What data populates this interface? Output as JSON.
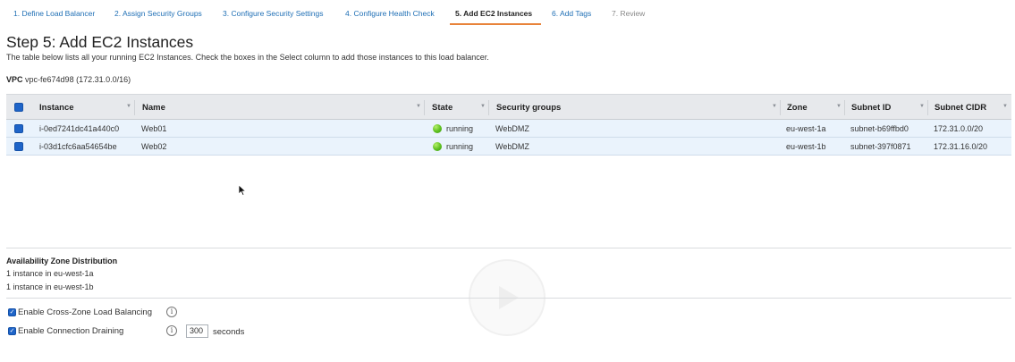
{
  "wizard": {
    "steps": [
      {
        "label": "1. Define Load Balancer"
      },
      {
        "label": "2. Assign Security Groups"
      },
      {
        "label": "3. Configure Security Settings"
      },
      {
        "label": "4. Configure Health Check"
      },
      {
        "label": "5. Add EC2 Instances"
      },
      {
        "label": "6. Add Tags"
      },
      {
        "label": "7. Review"
      }
    ],
    "active_step": 5
  },
  "page": {
    "title": "Step 5: Add EC2 Instances",
    "description": "The table below lists all your running EC2 Instances. Check the boxes in the Select column to add those instances to this load balancer."
  },
  "vpc": {
    "label": "VPC",
    "value": "vpc-fe674d98 (172.31.0.0/16)"
  },
  "table": {
    "columns": [
      "Instance",
      "Name",
      "State",
      "Security groups",
      "Zone",
      "Subnet ID",
      "Subnet CIDR"
    ],
    "rows": [
      {
        "instance": "i-0ed7241dc41a440c0",
        "name": "Web01",
        "state": "running",
        "security_groups": "WebDMZ",
        "zone": "eu-west-1a",
        "subnet_id": "subnet-b69ffbd0",
        "subnet_cidr": "172.31.0.0/20",
        "selected": true
      },
      {
        "instance": "i-03d1cfc6aa54654be",
        "name": "Web02",
        "state": "running",
        "security_groups": "WebDMZ",
        "zone": "eu-west-1b",
        "subnet_id": "subnet-397f0871",
        "subnet_cidr": "172.31.16.0/20",
        "selected": true
      }
    ]
  },
  "az_distribution": {
    "title": "Availability Zone Distribution",
    "lines": [
      "1 instance in eu-west-1a",
      "1 instance in eu-west-1b"
    ]
  },
  "options": {
    "cross_zone": {
      "label": "Enable Cross-Zone Load Balancing",
      "checked": true
    },
    "connection_draining": {
      "label": "Enable Connection Draining",
      "checked": true,
      "value": "300",
      "unit": "seconds"
    }
  },
  "colors": {
    "link": "#1f6fb5",
    "active_tab_underline": "#e8833a",
    "checkbox": "#1e64c8",
    "selected_row": "#eaf3fc",
    "header_bg": "#e7e9ec",
    "running": "#5cbf1f"
  },
  "icons": {
    "info": "info-icon",
    "sort": "sort-caret-icon",
    "status": "running-status-icon",
    "cursor": "mouse-cursor-icon"
  }
}
